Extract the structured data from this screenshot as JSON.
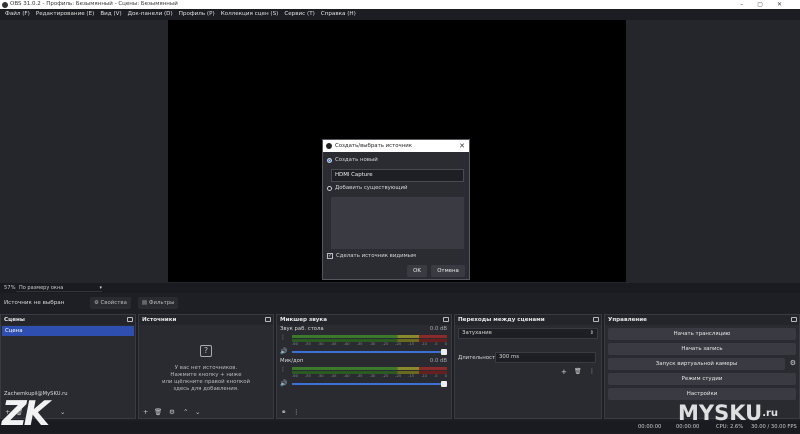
{
  "window": {
    "title": "OBS 31.0.2 - Профиль: Безымянный - Сцены: Безымянный"
  },
  "menu": [
    "Файл (F)",
    "Редактирование (E)",
    "Вид (V)",
    "Док-панели (D)",
    "Профиль (P)",
    "Коллекция сцен (S)",
    "Сервис (T)",
    "Справка (H)"
  ],
  "zoom": {
    "percent": "57%",
    "mode": "По размеру окна"
  },
  "source_bar": {
    "no_source": "Источник не выбран",
    "properties": "Свойства",
    "filters": "Фильтры"
  },
  "scenes": {
    "title": "Сцены",
    "items": [
      "Сцена"
    ],
    "user": "Zachemkupil@MySKU.ru"
  },
  "sources": {
    "title": "Источники",
    "empty_lines": [
      "У вас нет источников.",
      "Нажмите кнопку + ниже",
      "или щёлкните правой кнопкой",
      "здесь для добавления."
    ]
  },
  "mixer": {
    "title": "Микшер звука",
    "channels": [
      {
        "name": "Звук раб. стола",
        "db": "0.0 dB"
      },
      {
        "name": "Мик/доп",
        "db": "0.0 dB"
      }
    ],
    "ticks": [
      "-60",
      "-55",
      "-50",
      "-45",
      "-40",
      "-35",
      "-30",
      "-25",
      "-20",
      "-15",
      "-10",
      "-5",
      "0"
    ]
  },
  "transitions": {
    "title": "Переходы между сценами",
    "selected": "Затухание",
    "duration_label": "Длительность",
    "duration": "300 ms"
  },
  "controls": {
    "title": "Управление",
    "buttons": [
      "Начать трансляцию",
      "Начать запись",
      "Запуск виртуальной камеры",
      "Режим студии",
      "Настройки"
    ]
  },
  "status": {
    "t1": "00:00:00",
    "t2": "00:00:00",
    "cpu": "CPU: 2.6%",
    "fps": "30.00 / 30.00 FPS"
  },
  "dialog": {
    "title": "Создать/выбрать источник",
    "create_new": "Создать новый",
    "name_value": "HDMI Capture",
    "add_existing": "Добавить существующий",
    "make_visible": "Сделать источник видимым",
    "ok": "OK",
    "cancel": "Отмена"
  },
  "watermarks": {
    "left": "ZK",
    "right": "MYSKU",
    "right_suffix": ".ru"
  },
  "icons": {
    "plus": "+",
    "minus": "−",
    "gear": "⚙",
    "up": "▲",
    "down": "▼",
    "question": "?"
  }
}
